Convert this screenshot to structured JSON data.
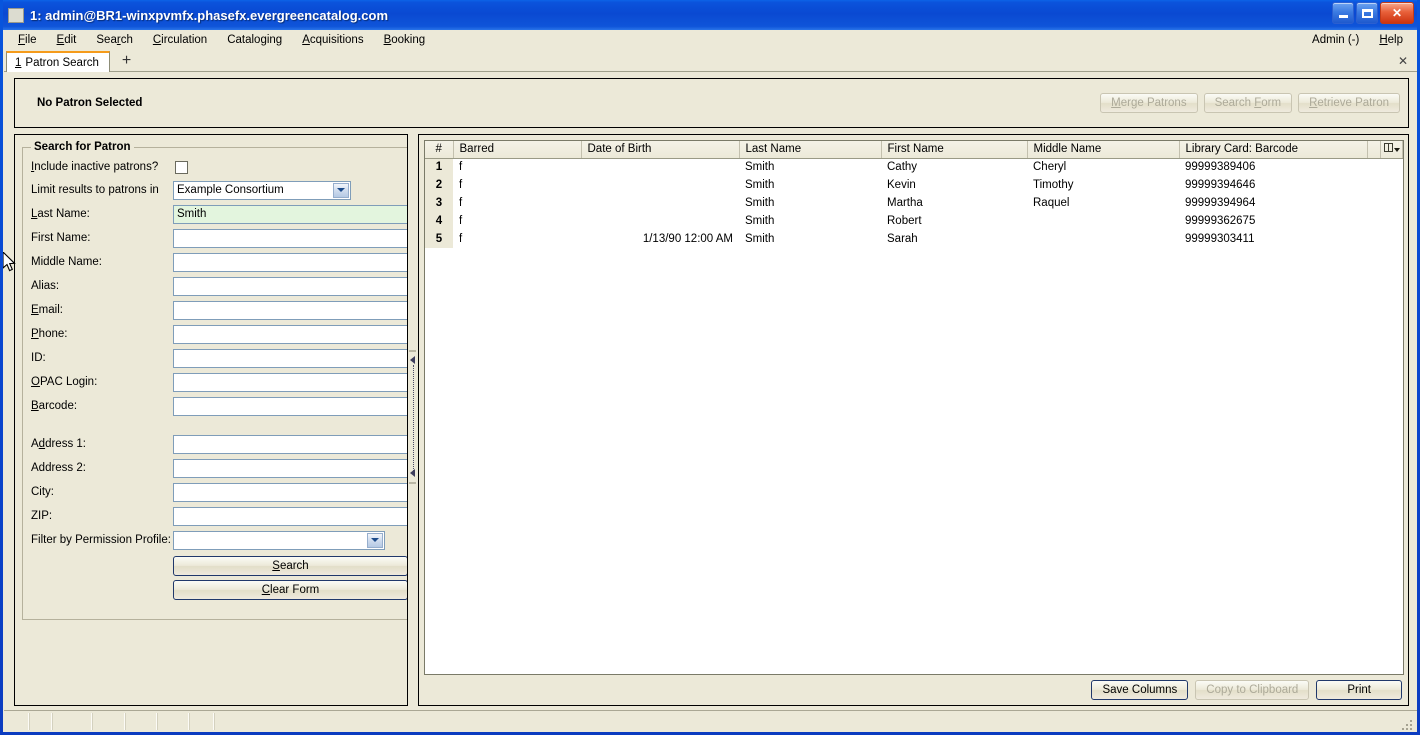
{
  "window": {
    "title": "1: admin@BR1-winxpvmfx.phasefx.evergreencatalog.com",
    "minimize_label": "Minimize",
    "maximize_label": "Maximize",
    "close_label": "✕"
  },
  "menubar": {
    "items": [
      {
        "label": "File",
        "accel": "F"
      },
      {
        "label": "Edit",
        "accel": "E"
      },
      {
        "label": "Search",
        "accel": "r"
      },
      {
        "label": "Circulation",
        "accel": "C"
      },
      {
        "label": "Cataloging",
        "accel": "g"
      },
      {
        "label": "Acquisitions",
        "accel": "A"
      },
      {
        "label": "Booking",
        "accel": "B"
      }
    ],
    "right_items": [
      {
        "label": "Admin (-)"
      },
      {
        "label": "Help",
        "accel": "H"
      }
    ]
  },
  "tabs": {
    "active": {
      "number": "1",
      "label": "Patron Search"
    },
    "new_tab_label": "+",
    "close_label": "✕"
  },
  "patron_bar": {
    "title": "No Patron Selected",
    "buttons": [
      {
        "label": "Merge Patrons",
        "disabled": true
      },
      {
        "label": "Search Form",
        "disabled": true
      },
      {
        "label": "Retrieve Patron",
        "disabled": true
      }
    ]
  },
  "search_form": {
    "legend": "Search for Patron",
    "include_inactive_label": "Include inactive patrons?",
    "include_inactive_checked": false,
    "limit_results_label": "Limit results to patrons in",
    "limit_results_value": "Example Consortium",
    "fields": [
      {
        "label": "Last Name:",
        "value": "Smith",
        "filled": true
      },
      {
        "label": "First Name:",
        "value": "",
        "filled": false
      },
      {
        "label": "Middle Name:",
        "value": "",
        "filled": false
      },
      {
        "label": "Alias:",
        "value": "",
        "filled": false
      },
      {
        "label": "Email:",
        "value": "",
        "filled": false
      },
      {
        "label": "Phone:",
        "value": "",
        "filled": false
      },
      {
        "label": "ID:",
        "value": "",
        "filled": false
      },
      {
        "label": "OPAC Login:",
        "value": "",
        "filled": false
      },
      {
        "label": "Barcode:",
        "value": "",
        "filled": false
      }
    ],
    "address_fields": [
      {
        "label": "Address 1:",
        "value": ""
      },
      {
        "label": "Address 2:",
        "value": ""
      },
      {
        "label": "City:",
        "value": ""
      },
      {
        "label": "ZIP:",
        "value": ""
      }
    ],
    "permission_profile_label": "Filter by Permission Profile:",
    "permission_profile_value": "",
    "search_button": "Search",
    "clear_button": "Clear Form"
  },
  "results": {
    "columns": [
      "#",
      "Barred",
      "Date of Birth",
      "Last Name",
      "First Name",
      "Middle Name",
      "Library Card: Barcode"
    ],
    "column_picker_icon": "column-picker-icon",
    "rows": [
      {
        "num": "1",
        "barred": "f",
        "dob": "",
        "last": "Smith",
        "first": "Cathy",
        "middle": "Cheryl",
        "card": "99999389406"
      },
      {
        "num": "2",
        "barred": "f",
        "dob": "",
        "last": "Smith",
        "first": "Kevin",
        "middle": "Timothy",
        "card": "99999394646"
      },
      {
        "num": "3",
        "barred": "f",
        "dob": "",
        "last": "Smith",
        "first": "Martha",
        "middle": "Raquel",
        "card": "99999394964"
      },
      {
        "num": "4",
        "barred": "f",
        "dob": "",
        "last": "Smith",
        "first": "Robert",
        "middle": "",
        "card": "99999362675"
      },
      {
        "num": "5",
        "barred": "f",
        "dob": "1/13/90 12:00 AM",
        "last": "Smith",
        "first": "Sarah",
        "middle": "",
        "card": "99999303411"
      }
    ],
    "footer_buttons": [
      {
        "label": "Save Columns",
        "disabled": false
      },
      {
        "label": "Copy to Clipboard",
        "disabled": true
      },
      {
        "label": "Print",
        "disabled": false
      }
    ]
  },
  "colors": {
    "titlebar": "#0a46cf",
    "client": "#ece9d8",
    "tab_accent": "#f59b1b",
    "filled_input": "#e3f5de",
    "input_border": "#7f9db9"
  }
}
